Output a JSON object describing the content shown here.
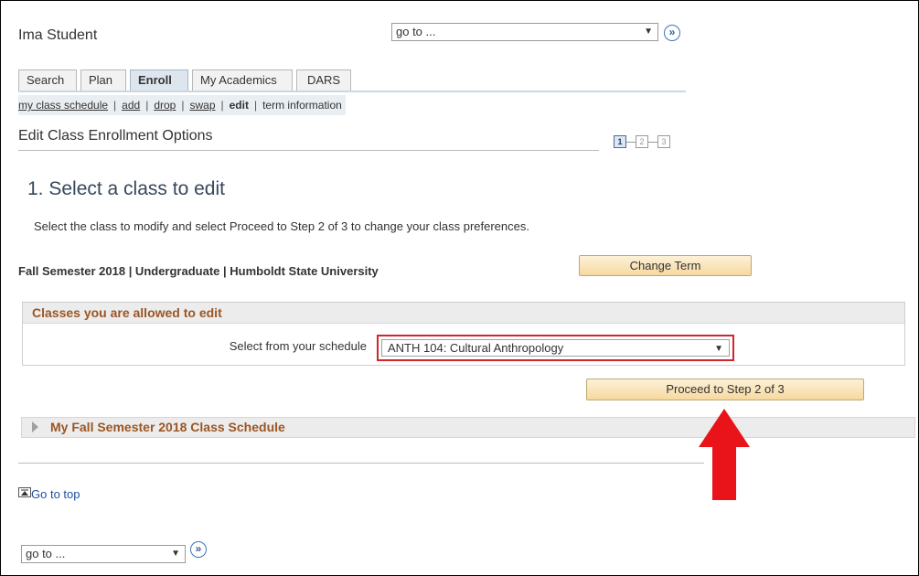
{
  "header": {
    "user_name": "Ima Student",
    "goto_value": "go to ...",
    "go_button": "»"
  },
  "tabs": [
    {
      "label": "Search"
    },
    {
      "label": "Plan"
    },
    {
      "label": "Enroll"
    },
    {
      "label": "My Academics"
    },
    {
      "label": "DARS"
    }
  ],
  "subnav": [
    {
      "label": "my class schedule"
    },
    {
      "label": "add"
    },
    {
      "label": "drop"
    },
    {
      "label": "swap"
    },
    {
      "label": "edit"
    },
    {
      "label": "term information"
    }
  ],
  "page": {
    "title": "Edit Class Enrollment Options",
    "steps": [
      "1",
      "2",
      "3"
    ],
    "step_heading": "1.  Select a class to edit",
    "instructions": "Select the class to modify and select Proceed to Step 2 of 3 to change your class preferences.",
    "term_info": "Fall Semester 2018 | Undergraduate | Humboldt State University",
    "change_term_button": "Change Term"
  },
  "classes_panel": {
    "header": "Classes you are allowed to edit",
    "select_label": "Select from your schedule",
    "selected_class": "ANTH 104: Cultural Anthropology"
  },
  "proceed_button": "Proceed to Step 2 of 3",
  "schedule_section": {
    "label": "My Fall Semester 2018 Class Schedule"
  },
  "footer": {
    "go_to_top": "Go to top",
    "goto_value": "go to ...",
    "go_button": "»"
  },
  "colors": {
    "annotation_arrow": "#e8141a",
    "highlight_box": "#d0262d",
    "section_header_text": "#9b5523"
  }
}
